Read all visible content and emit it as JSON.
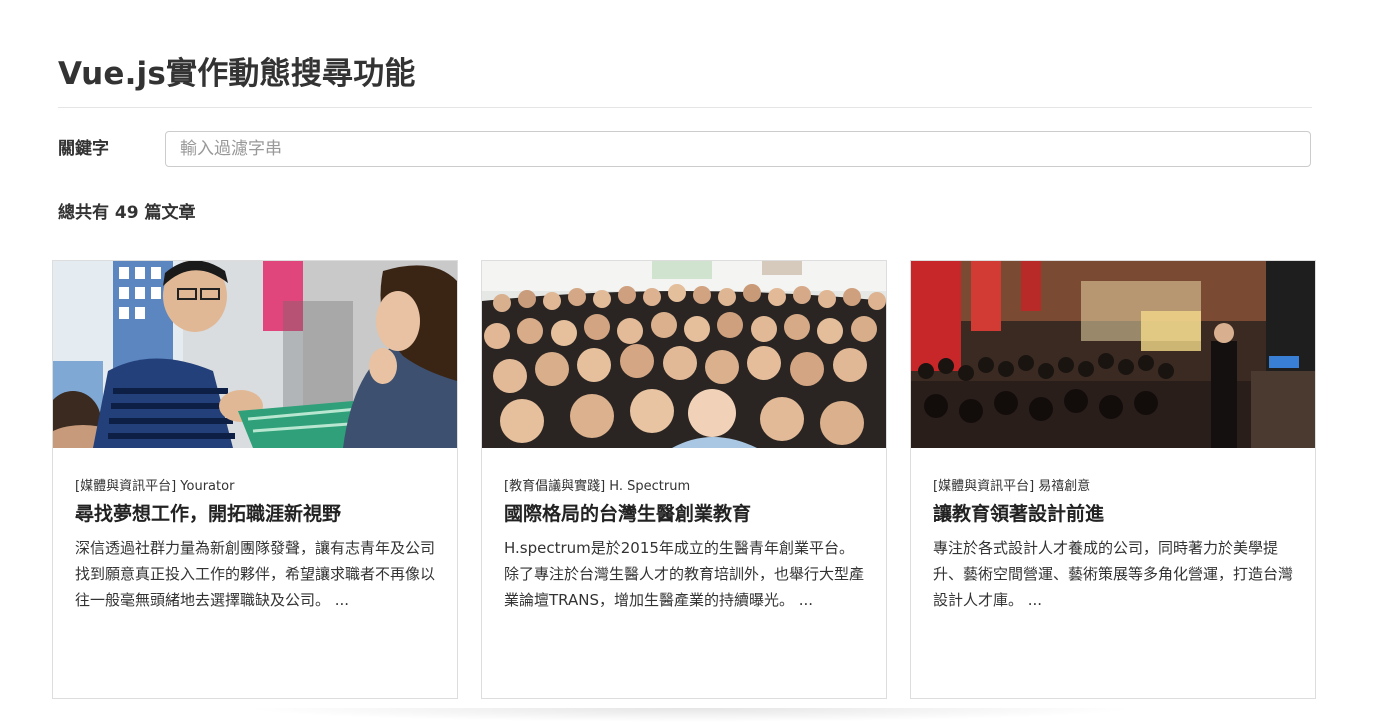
{
  "header": {
    "title": "Vue.js實作動態搜尋功能"
  },
  "search": {
    "label": "關鍵字",
    "placeholder": "輸入過濾字串",
    "value": ""
  },
  "summary": {
    "text": "總共有 49 篇文章"
  },
  "colors": {
    "border": "#dddddd",
    "text": "#333333",
    "placeholder": "#999999"
  },
  "cards": [
    {
      "image_icon": "photo-job-fair",
      "category": "[媒體與資訊平台]",
      "source": "Yourator",
      "title": "尋找夢想工作，開拓職涯新視野",
      "description": "深信透過社群力量為新創團隊發聲，讓有志青年及公司找到願意真正投入工作的夥伴，希望讓求職者不再像以往一般毫無頭緒地去選擇職缺及公司。 ..."
    },
    {
      "image_icon": "photo-group-selfie",
      "category": "[教育倡議與實踐]",
      "source": "H. Spectrum",
      "title": "國際格局的台灣生醫創業教育",
      "description": "H.spectrum是於2015年成立的生醫青年創業平台。除了專注於台灣生醫人才的教育培訓外，也舉行大型產業論壇TRANS，增加生醫產業的持續曝光。 ..."
    },
    {
      "image_icon": "photo-event-hall",
      "category": "[媒體與資訊平台]",
      "source": "易禧創意",
      "title": "讓教育領著設計前進",
      "description": "專注於各式設計人才養成的公司，同時著力於美學提升、藝術空間營運、藝術策展等多角化營運，打造台灣設計人才庫。 ..."
    }
  ]
}
